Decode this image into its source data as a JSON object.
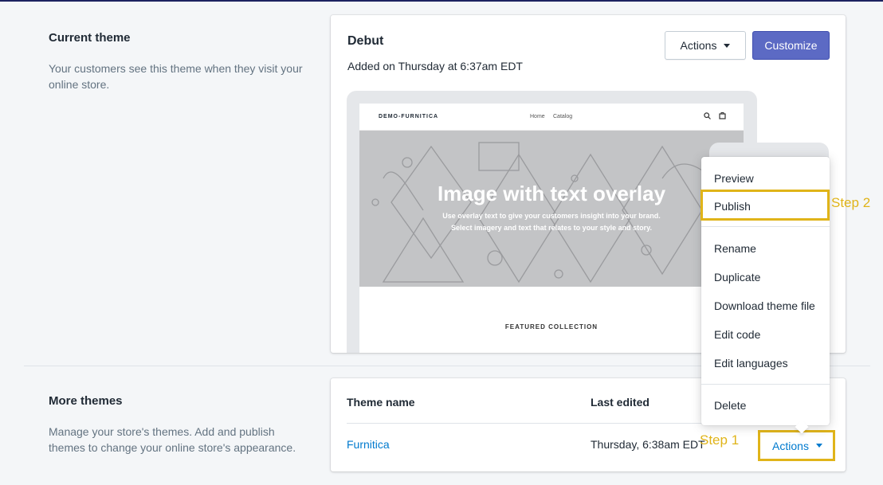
{
  "current_theme": {
    "section_title": "Current theme",
    "description": "Your customers see this theme when they visit your online store.",
    "theme_name": "Debut",
    "added_on": "Added on Thursday at 6:37am EDT",
    "actions_label": "Actions",
    "customize_label": "Customize"
  },
  "preview": {
    "store_name": "DEMO-FURNITICA",
    "nav_links": [
      "Home",
      "Catalog"
    ],
    "hero_title": "Image with text overlay",
    "hero_subtitle_1": "Use overlay text to give your customers insight into your brand.",
    "hero_subtitle_2": "Select imagery and text that relates to your style and story.",
    "featured_title": "FEATURED COLLECTION"
  },
  "dropdown": {
    "items": [
      "Preview",
      "Publish",
      "Rename",
      "Duplicate",
      "Download theme file",
      "Edit code",
      "Edit languages",
      "Delete"
    ]
  },
  "annotations": {
    "step1": "Step 1",
    "step2": "Step 2",
    "highlight_color": "#e0b419"
  },
  "more_themes": {
    "section_title": "More themes",
    "description": "Manage your store's themes. Add and publish themes to change your online store's appearance.",
    "col_theme_name": "Theme name",
    "col_last_edited": "Last edited",
    "rows": [
      {
        "name": "Furnitica",
        "last_edited": "Thursday, 6:38am EDT",
        "actions_label": "Actions"
      }
    ]
  },
  "colors": {
    "primary": "#5c6ac4",
    "link": "#007ace",
    "background": "#f4f6f8"
  }
}
